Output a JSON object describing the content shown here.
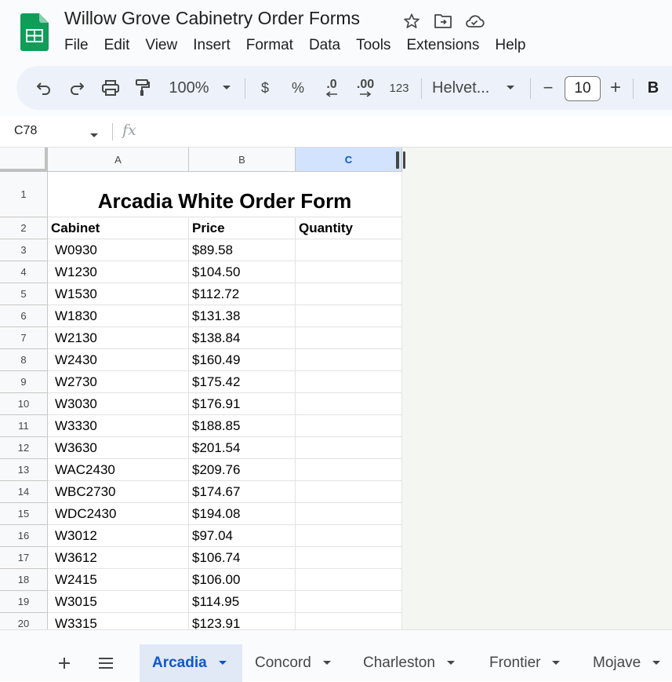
{
  "app": {
    "doc_title": "Willow Grove Cabinetry Order Forms",
    "menu": [
      "File",
      "Edit",
      "View",
      "Insert",
      "Format",
      "Data",
      "Tools",
      "Extensions",
      "Help"
    ]
  },
  "toolbar": {
    "zoom": "100%",
    "currency": "$",
    "percent": "%",
    "decrease_decimal": ".0",
    "increase_decimal": ".00",
    "number_format": "123",
    "font": "Helvet...",
    "font_size": "10",
    "minus": "−",
    "plus": "+",
    "bold": "B"
  },
  "formula_bar": {
    "cell_ref": "C78",
    "fx": "fx"
  },
  "sheet": {
    "columns": [
      "A",
      "B",
      "C"
    ],
    "selected_column": "C",
    "title_row": "1",
    "title": "Arcadia White Order Form",
    "header_row": "2",
    "headers": [
      "Cabinet",
      "Price",
      "Quantity"
    ],
    "rows": [
      {
        "n": "3",
        "cabinet": "W0930",
        "price": "$89.58",
        "qty": ""
      },
      {
        "n": "4",
        "cabinet": "W1230",
        "price": "$104.50",
        "qty": ""
      },
      {
        "n": "5",
        "cabinet": "W1530",
        "price": "$112.72",
        "qty": ""
      },
      {
        "n": "6",
        "cabinet": "W1830",
        "price": "$131.38",
        "qty": ""
      },
      {
        "n": "7",
        "cabinet": "W2130",
        "price": "$138.84",
        "qty": ""
      },
      {
        "n": "8",
        "cabinet": "W2430",
        "price": "$160.49",
        "qty": ""
      },
      {
        "n": "9",
        "cabinet": "W2730",
        "price": "$175.42",
        "qty": ""
      },
      {
        "n": "10",
        "cabinet": "W3030",
        "price": "$176.91",
        "qty": ""
      },
      {
        "n": "11",
        "cabinet": "W3330",
        "price": "$188.85",
        "qty": ""
      },
      {
        "n": "12",
        "cabinet": "W3630",
        "price": "$201.54",
        "qty": ""
      },
      {
        "n": "13",
        "cabinet": "WAC2430",
        "price": "$209.76",
        "qty": ""
      },
      {
        "n": "14",
        "cabinet": "WBC2730",
        "price": "$174.67",
        "qty": ""
      },
      {
        "n": "15",
        "cabinet": "WDC2430",
        "price": "$194.08",
        "qty": ""
      },
      {
        "n": "16",
        "cabinet": "W3012",
        "price": "$97.04",
        "qty": ""
      },
      {
        "n": "17",
        "cabinet": "W3612",
        "price": "$106.74",
        "qty": ""
      },
      {
        "n": "18",
        "cabinet": "W2415",
        "price": "$106.00",
        "qty": ""
      },
      {
        "n": "19",
        "cabinet": "W3015",
        "price": "$114.95",
        "qty": ""
      },
      {
        "n": "20",
        "cabinet": "W3315",
        "price": "$123.91",
        "qty": ""
      }
    ]
  },
  "tabs": {
    "items": [
      "Arcadia",
      "Concord",
      "Charleston",
      "Frontier",
      "Mojave"
    ],
    "active": "Arcadia"
  },
  "colors": {
    "accent": "#0b57d0",
    "sheets_green": "#0f9d58",
    "toolbar_bg": "#edf2fa",
    "active_tab_bg": "#e1e9f7"
  }
}
